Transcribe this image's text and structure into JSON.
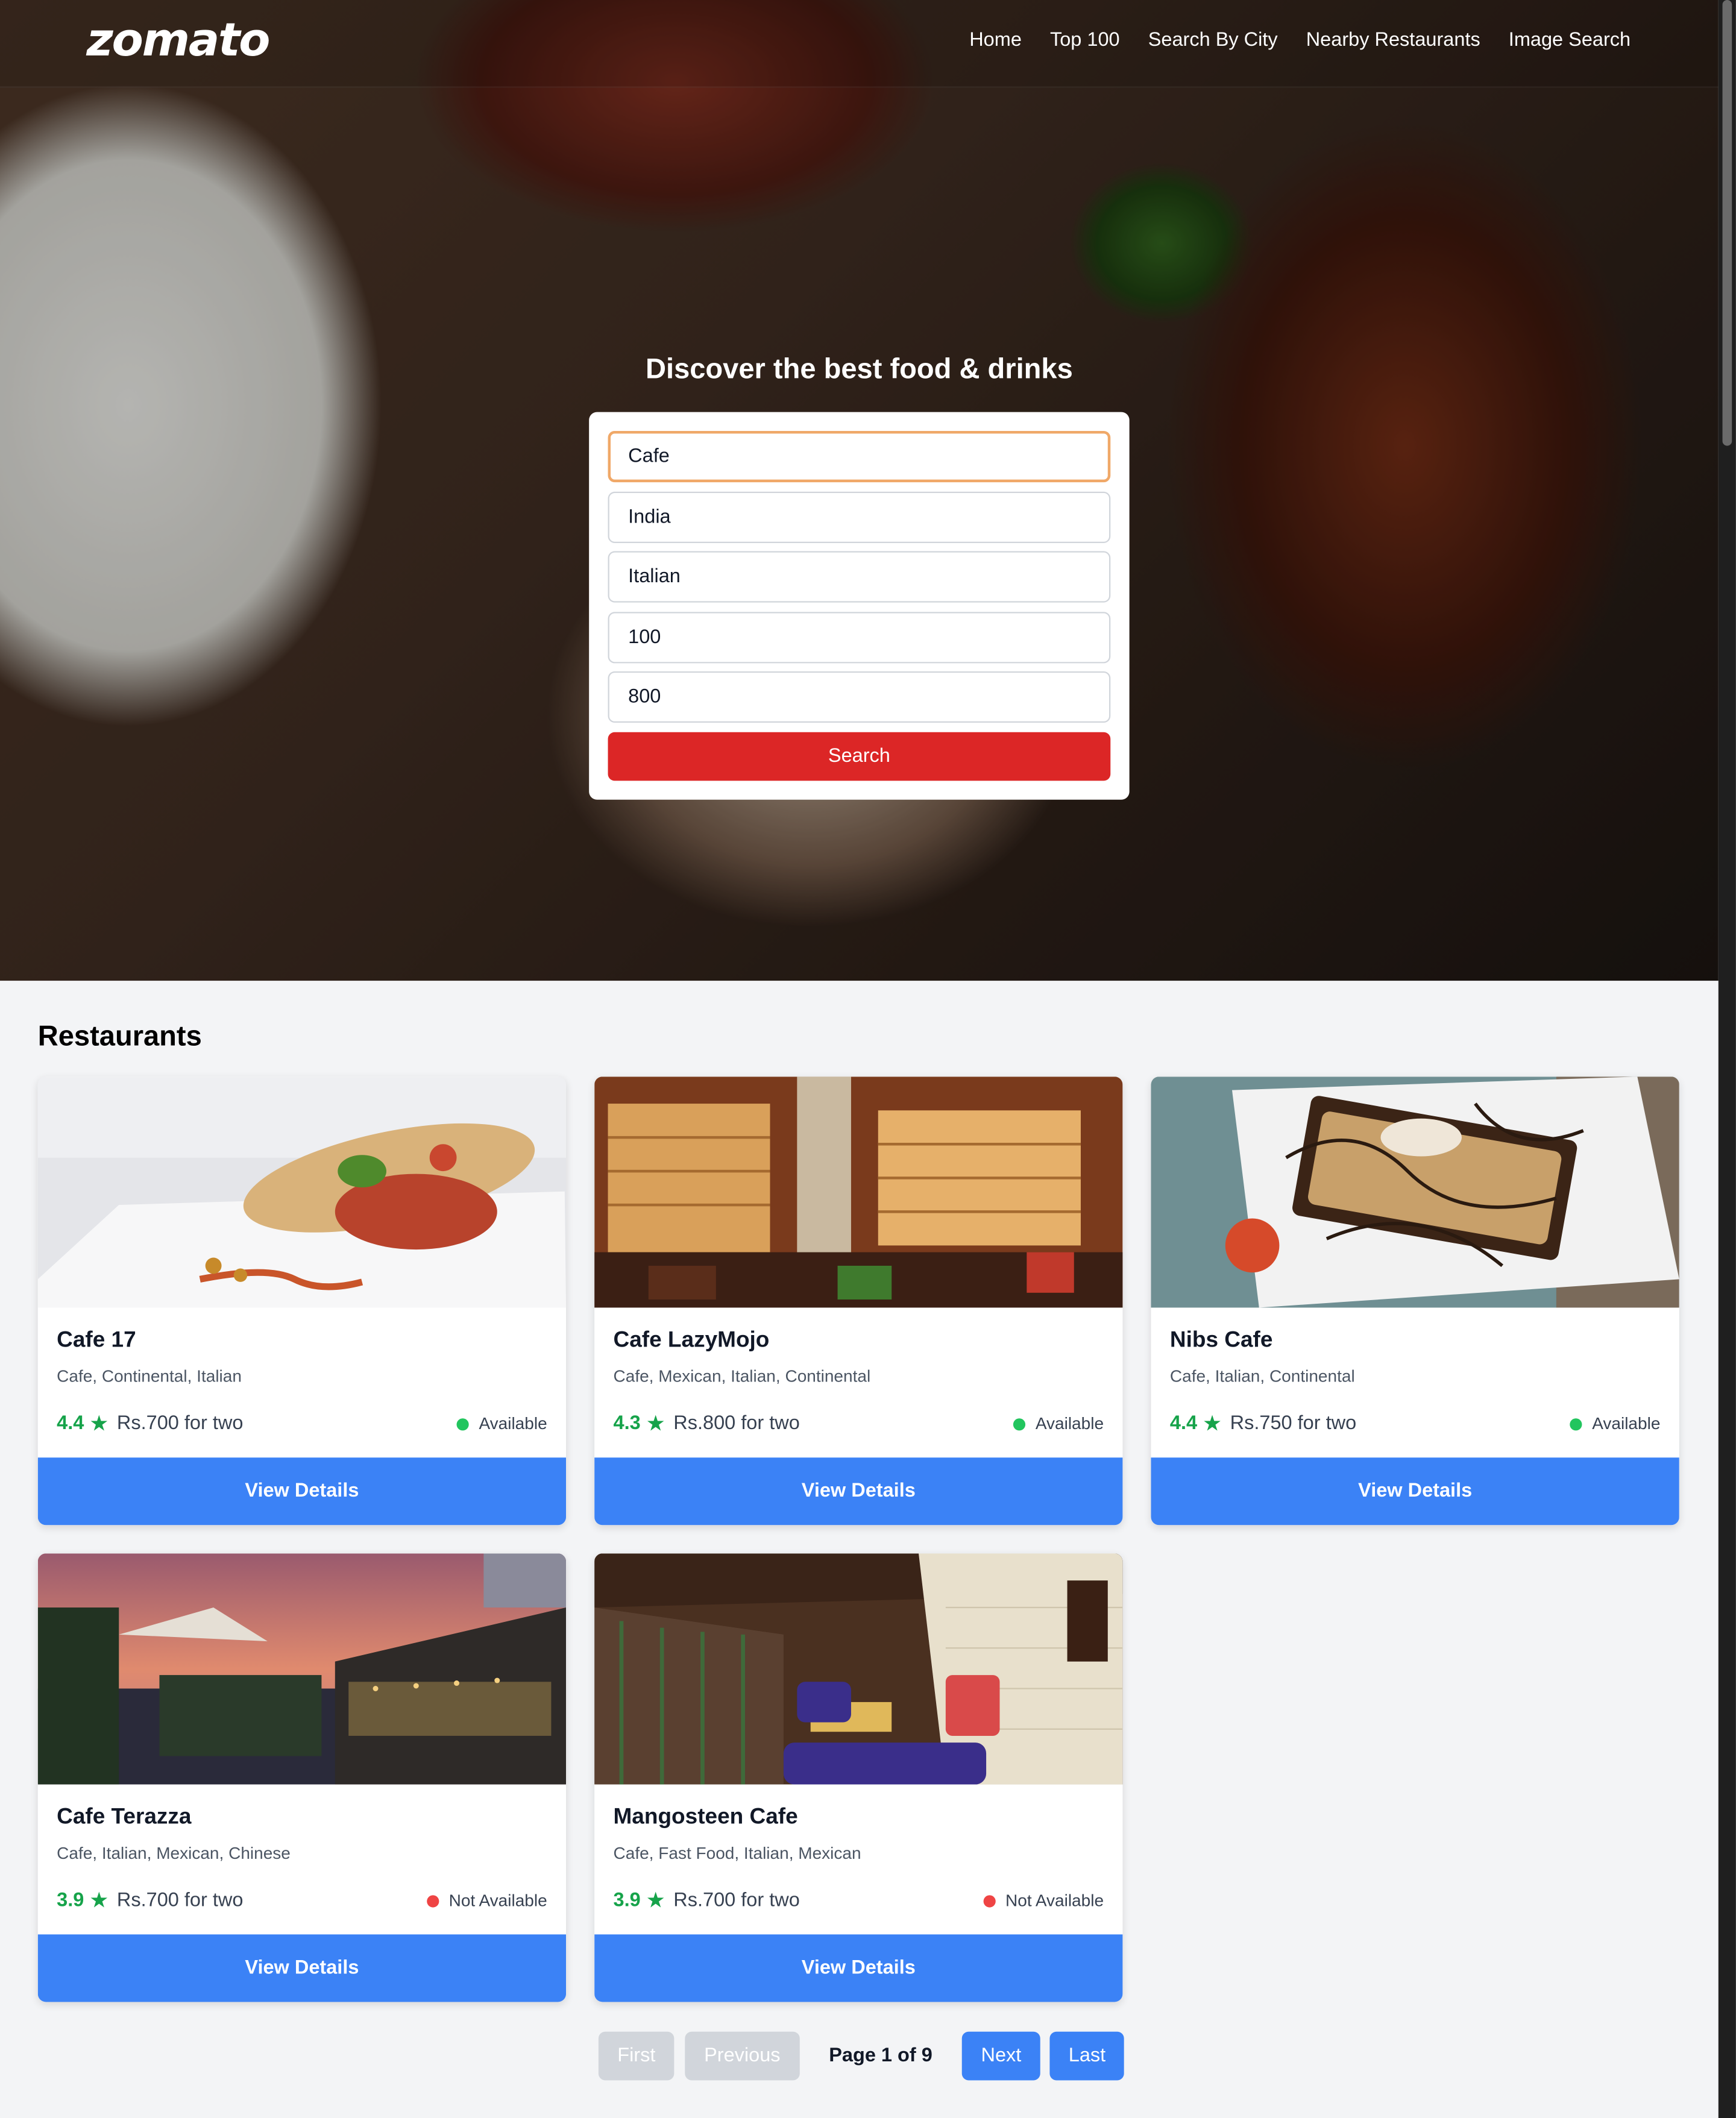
{
  "nav": {
    "logo": "zomato",
    "links": [
      "Home",
      "Top 100",
      "Search By City",
      "Nearby Restaurants",
      "Image Search"
    ]
  },
  "hero": {
    "title": "Discover the best food & drinks",
    "fields": [
      "Cafe",
      "India",
      "Italian",
      "100",
      "800"
    ],
    "search_label": "Search"
  },
  "results": {
    "title": "Restaurants",
    "view_label": "View Details",
    "restaurants": [
      {
        "name": "Cafe 17",
        "cuisines": "Cafe, Continental, Italian",
        "rating": "4.4",
        "price": "Rs.700 for two",
        "status": "Available"
      },
      {
        "name": "Cafe LazyMojo",
        "cuisines": "Cafe, Mexican, Italian, Continental",
        "rating": "4.3",
        "price": "Rs.800 for two",
        "status": "Available"
      },
      {
        "name": "Nibs Cafe",
        "cuisines": "Cafe, Italian, Continental",
        "rating": "4.4",
        "price": "Rs.750 for two",
        "status": "Available"
      },
      {
        "name": "Cafe Terazza",
        "cuisines": "Cafe, Italian, Mexican, Chinese",
        "rating": "3.9",
        "price": "Rs.700 for two",
        "status": "Not Available"
      },
      {
        "name": "Mangosteen Cafe",
        "cuisines": "Cafe, Fast Food, Italian, Mexican",
        "rating": "3.9",
        "price": "Rs.700 for two",
        "status": "Not Available"
      }
    ]
  },
  "pagination": {
    "first": "First",
    "previous": "Previous",
    "info": "Page 1 of 9",
    "next": "Next",
    "last": "Last"
  },
  "colors": {
    "accent_red": "#dc2626",
    "button_blue": "#3b82f6",
    "rating_green": "#16a34a",
    "available_dot": "#22c55e",
    "unavailable_dot": "#ef4444"
  },
  "icons": {
    "rating": "star-icon",
    "status": "status-dot-icon"
  }
}
